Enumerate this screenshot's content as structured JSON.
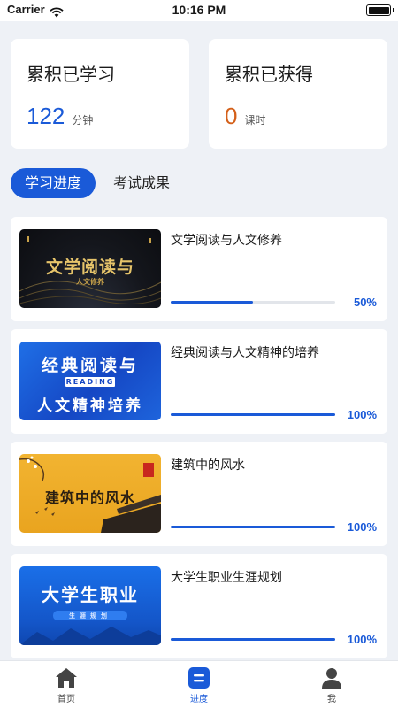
{
  "status_bar": {
    "carrier": "Carrier",
    "time": "10:16 PM"
  },
  "stats": {
    "studied": {
      "title": "累积已学习",
      "value": "122",
      "unit": "分钟"
    },
    "earned": {
      "title": "累积已获得",
      "value": "0",
      "unit": "课时"
    }
  },
  "tabs": [
    {
      "label": "学习进度",
      "active": true
    },
    {
      "label": "考试成果",
      "active": false
    }
  ],
  "courses": [
    {
      "title": "文学阅读与人文修养",
      "progress": 0.5,
      "progress_label": "50%",
      "thumb_text": "文学阅读与",
      "thumb_sub": "人文修养"
    },
    {
      "title": "经典阅读与人文精神的培养",
      "progress": 1.0,
      "progress_label": "100%",
      "thumb_text": "经典阅读与",
      "thumb_badge": "READING",
      "thumb_sub": "人文精神培养"
    },
    {
      "title": "建筑中的风水",
      "progress": 1.0,
      "progress_label": "100%",
      "thumb_text": "建筑中的风水"
    },
    {
      "title": "大学生职业生涯规划",
      "progress": 1.0,
      "progress_label": "100%",
      "thumb_text": "大学生职业",
      "thumb_sub": "生涯规划"
    }
  ],
  "tabbar": [
    {
      "label": "首页",
      "icon": "home-icon",
      "active": false
    },
    {
      "label": "进度",
      "icon": "progress-icon",
      "active": true
    },
    {
      "label": "我",
      "icon": "person-icon",
      "active": false
    }
  ],
  "colors": {
    "accent": "#1a5ad8",
    "orange": "#d4601a",
    "background": "#eef1f6"
  }
}
